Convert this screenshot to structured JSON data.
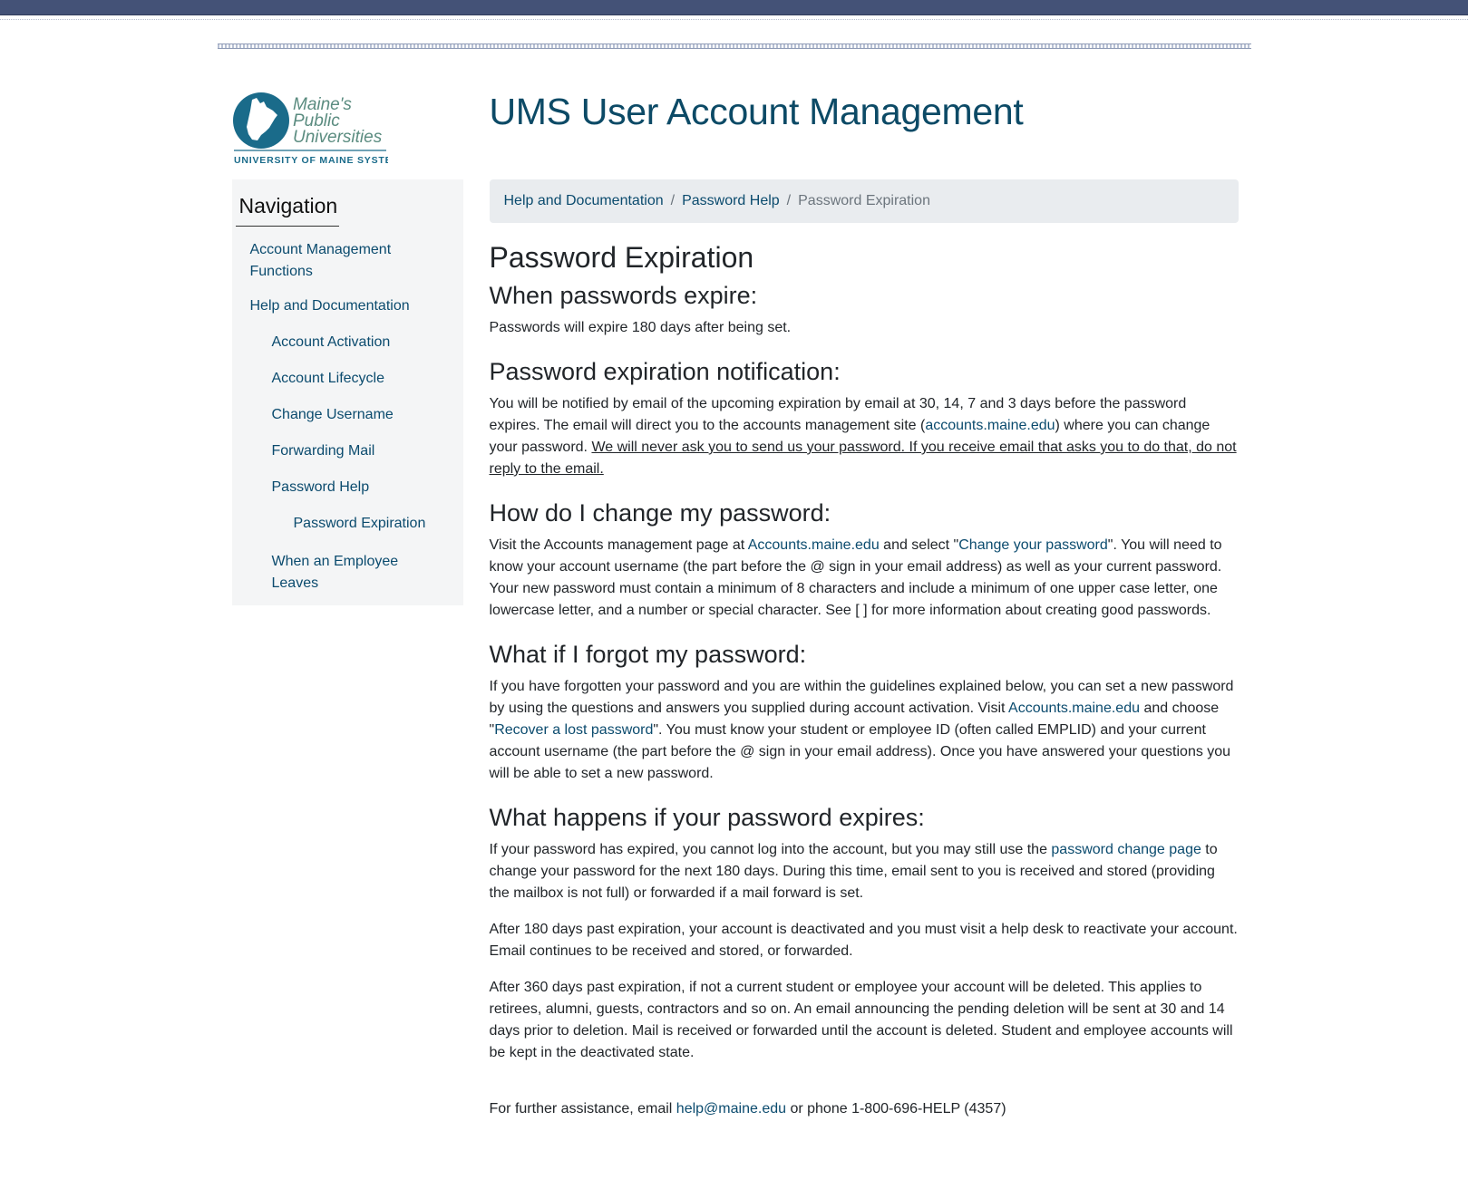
{
  "app": {
    "title": "UMS User Account Management",
    "logo": {
      "line1": "Maine's",
      "line2": "Public",
      "line3": "Universities",
      "tagline": "UNIVERSITY OF MAINE SYSTEM"
    }
  },
  "sidebar": {
    "heading": "Navigation",
    "items": [
      {
        "label": "Account Management Functions"
      },
      {
        "label": "Help and Documentation"
      },
      {
        "label": "Account Activation"
      },
      {
        "label": "Account Lifecycle"
      },
      {
        "label": "Change Username"
      },
      {
        "label": "Forwarding Mail"
      },
      {
        "label": "Password Help"
      },
      {
        "label": "Password Expiration"
      },
      {
        "label": "When an Employee Leaves"
      }
    ]
  },
  "breadcrumb": {
    "items": [
      "Help and Documentation",
      "Password Help",
      "Password Expiration"
    ],
    "separator": "/"
  },
  "content": {
    "title": "Password Expiration",
    "s1": {
      "heading": "When passwords expire:",
      "p1": "Passwords will expire 180 days after being set."
    },
    "s2": {
      "heading": "Password expiration notification:",
      "p1_a": "You will be notified by email of the upcoming expiration by email at 30, 14, 7 and 3 days before the password expires. The email will direct you to the accounts management site (",
      "p1_link": "accounts.maine.edu",
      "p1_b": ") where you can change your password. ",
      "p1_warning": "We will never ask you to send us your password. If you receive email that asks you to do that, do not reply to the email."
    },
    "s3": {
      "heading": "How do I change my password:",
      "p1_a": "Visit the Accounts management page at ",
      "p1_link1": "Accounts.maine.edu",
      "p1_b": " and select \"",
      "p1_link2": "Change your password",
      "p1_c": "\". You will need to know your account username (the part before the @ sign in your email address) as well as your current password. Your new password must contain a minimum of 8 characters and include a minimum of one upper case letter, one lowercase letter, and a number or special character. See [ ] for more information about creating good passwords."
    },
    "s4": {
      "heading": "What if I forgot my password:",
      "p1_a": "If you have forgotten your password and you are within the guidelines explained below, you can set a new password by using the questions and answers you supplied during account activation. Visit ",
      "p1_link1": "Accounts.maine.edu",
      "p1_b": " and choose \"",
      "p1_link2": "Recover a lost password",
      "p1_c": "\". You must know your student or employee ID (often called EMPLID) and your current account username (the part before the @ sign in your email address). Once you have answered your questions you will be able to set a new password."
    },
    "s5": {
      "heading": "What happens if your password expires:",
      "p1_a": "If your password has expired, you cannot log into the account, but you may still use the ",
      "p1_link": "password change page",
      "p1_b": " to change your password for the next 180 days. During this time, email sent to you is received and stored (providing the mailbox is not full) or forwarded if a mail forward is set.",
      "p2": "After 180 days past expiration, your account is deactivated and you must visit a help desk to reactivate your account. Email continues to be received and stored, or forwarded.",
      "p3": "After 360 days past expiration, if not a current student or employee your account will be deleted. This applies to retirees, alumni, guests, contractors and so on. An email announcing the pending deletion will be sent at 30 and 14 days prior to deletion. Mail is received or forwarded until the account is deleted. Student and employee accounts will be kept in the deactivated state."
    },
    "footer": {
      "a": "For further assistance, email ",
      "email": "help@maine.edu",
      "b": " or phone 1-800-696-HELP (4357)"
    }
  },
  "colors": {
    "topbar": "#445277",
    "link": "#0b4b6e",
    "title": "#0c4a66",
    "logo_teal": "#1a6b8a",
    "sidebar_bg": "#f4f5f6",
    "breadcrumb_bg": "#e9ecef"
  }
}
